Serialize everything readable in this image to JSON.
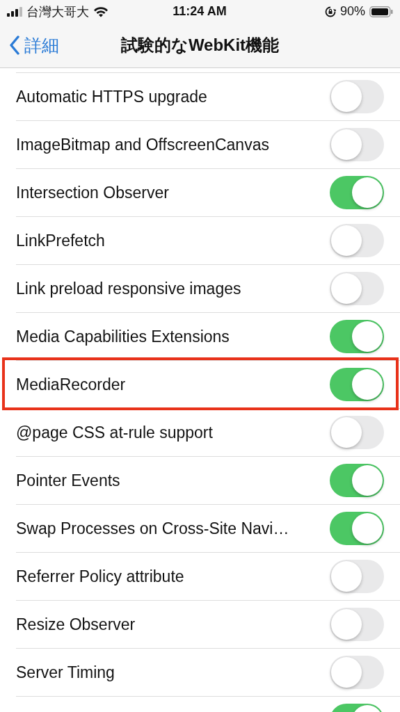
{
  "status_bar": {
    "carrier": "台灣大哥大",
    "time": "11:24 AM",
    "battery": "90%"
  },
  "nav": {
    "back": "詳細",
    "title": "試験的なWebKit機能"
  },
  "rows": [
    {
      "label": "Automatic HTTPS upgrade",
      "on": false,
      "highlighted": false
    },
    {
      "label": "ImageBitmap and OffscreenCanvas",
      "on": false,
      "highlighted": false
    },
    {
      "label": "Intersection Observer",
      "on": true,
      "highlighted": false
    },
    {
      "label": "LinkPrefetch",
      "on": false,
      "highlighted": false
    },
    {
      "label": "Link preload responsive images",
      "on": false,
      "highlighted": false
    },
    {
      "label": "Media Capabilities Extensions",
      "on": true,
      "highlighted": false
    },
    {
      "label": "MediaRecorder",
      "on": true,
      "highlighted": true
    },
    {
      "label": "@page CSS at-rule support",
      "on": false,
      "highlighted": false
    },
    {
      "label": "Pointer Events",
      "on": true,
      "highlighted": false
    },
    {
      "label": "Swap Processes on Cross-Site Navi…",
      "on": true,
      "highlighted": false
    },
    {
      "label": "Referrer Policy attribute",
      "on": false,
      "highlighted": false
    },
    {
      "label": "Resize Observer",
      "on": false,
      "highlighted": false
    },
    {
      "label": "Server Timing",
      "on": false,
      "highlighted": false
    },
    {
      "on": true,
      "highlighted": false
    }
  ]
}
